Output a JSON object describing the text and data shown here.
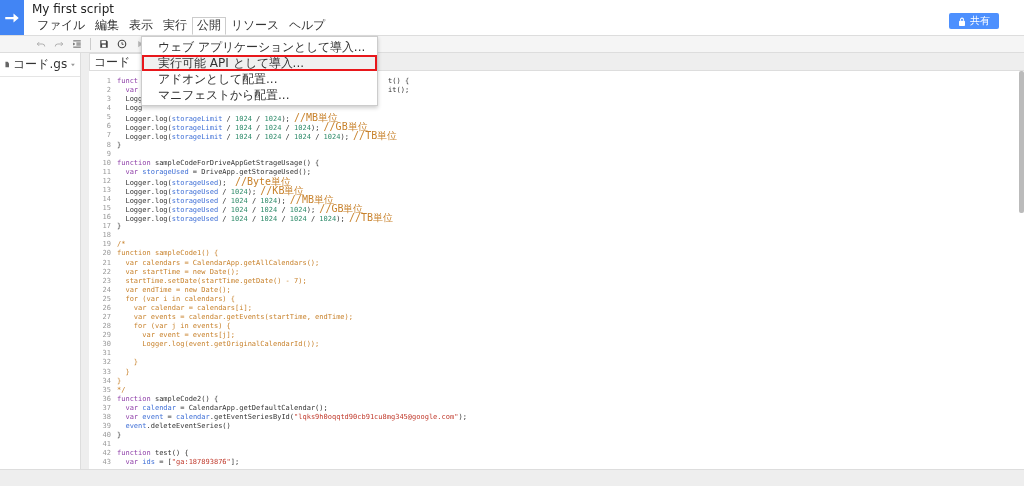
{
  "header": {
    "title": "My first script",
    "share_button": "共有"
  },
  "menu": [
    {
      "label": "ファイル",
      "selected": false
    },
    {
      "label": "編集",
      "selected": false
    },
    {
      "label": "表示",
      "selected": false
    },
    {
      "label": "実行",
      "selected": false
    },
    {
      "label": "公開",
      "selected": true
    },
    {
      "label": "リソース",
      "selected": false
    },
    {
      "label": "ヘルプ",
      "selected": false
    }
  ],
  "dropdown": [
    {
      "label": "ウェブ アプリケーションとして導入...",
      "highlighted": false
    },
    {
      "label": "実行可能 API として導入...",
      "highlighted": true
    },
    {
      "label": "アドオンとして配置...",
      "highlighted": false
    },
    {
      "label": "マニフェストから配置...",
      "highlighted": false
    }
  ],
  "files": [
    {
      "name": "コード.gs"
    }
  ],
  "editor_tab": "コード",
  "lines": [
    {
      "n": "1",
      "s": [
        {
          "t": "funct",
          "kind": "kw"
        },
        {
          "t": "t() {",
          "kind": "cover"
        }
      ]
    },
    {
      "n": "2",
      "s": [
        {
          "t": "  var",
          "kind": "kw"
        },
        {
          "t": "it();",
          "kind": "cover"
        }
      ]
    },
    {
      "n": "3",
      "s": [
        {
          "t": "  Logg",
          "kind": "pl"
        }
      ]
    },
    {
      "n": "4",
      "s": [
        {
          "t": "  Logg",
          "kind": "pl"
        }
      ]
    },
    {
      "n": "5",
      "s": [
        {
          "t": "  Logger.log(",
          "kind": "pl"
        },
        {
          "t": "storageLimit",
          "kind": "id"
        },
        {
          "t": " / ",
          "kind": "pl"
        },
        {
          "t": "1024",
          "kind": "num"
        },
        {
          "t": " / ",
          "kind": "pl"
        },
        {
          "t": "1024",
          "kind": "num"
        },
        {
          "t": "); ",
          "kind": "pl"
        },
        {
          "t": "//MB単位",
          "kind": "com"
        }
      ]
    },
    {
      "n": "6",
      "s": [
        {
          "t": "  Logger.log(",
          "kind": "pl"
        },
        {
          "t": "storageLimit",
          "kind": "id"
        },
        {
          "t": " / ",
          "kind": "pl"
        },
        {
          "t": "1024",
          "kind": "num"
        },
        {
          "t": " / ",
          "kind": "pl"
        },
        {
          "t": "1024",
          "kind": "num"
        },
        {
          "t": " / ",
          "kind": "pl"
        },
        {
          "t": "1024",
          "kind": "num"
        },
        {
          "t": "); ",
          "kind": "pl"
        },
        {
          "t": "//GB単位",
          "kind": "com"
        }
      ]
    },
    {
      "n": "7",
      "s": [
        {
          "t": "  Logger.log(",
          "kind": "pl"
        },
        {
          "t": "storageLimit",
          "kind": "id"
        },
        {
          "t": " / ",
          "kind": "pl"
        },
        {
          "t": "1024",
          "kind": "num"
        },
        {
          "t": " / ",
          "kind": "pl"
        },
        {
          "t": "1024",
          "kind": "num"
        },
        {
          "t": " / ",
          "kind": "pl"
        },
        {
          "t": "1024",
          "kind": "num"
        },
        {
          "t": " / ",
          "kind": "pl"
        },
        {
          "t": "1024",
          "kind": "num"
        },
        {
          "t": "); ",
          "kind": "pl"
        },
        {
          "t": "//TB単位",
          "kind": "com"
        }
      ]
    },
    {
      "n": "8",
      "s": [
        {
          "t": "}",
          "kind": "pl"
        }
      ]
    },
    {
      "n": "9"
    },
    {
      "n": "10",
      "s": [
        {
          "t": "function",
          "kind": "kw"
        },
        {
          "t": " sampleCodeForDriveAppGetStrageUsage() {",
          "kind": "pl"
        }
      ]
    },
    {
      "n": "11",
      "s": [
        {
          "t": "  var",
          "kind": "kw"
        },
        {
          "t": " storageUsed",
          "kind": "id"
        },
        {
          "t": " = DriveApp.getStorageUsed();",
          "kind": "pl"
        }
      ]
    },
    {
      "n": "12",
      "s": [
        {
          "t": "  Logger.log(",
          "kind": "pl"
        },
        {
          "t": "storageUsed",
          "kind": "id"
        },
        {
          "t": ");  ",
          "kind": "pl"
        },
        {
          "t": "//Byte単位",
          "kind": "com"
        }
      ]
    },
    {
      "n": "13",
      "s": [
        {
          "t": "  Logger.log(",
          "kind": "pl"
        },
        {
          "t": "storageUsed",
          "kind": "id"
        },
        {
          "t": " / ",
          "kind": "pl"
        },
        {
          "t": "1024",
          "kind": "num"
        },
        {
          "t": "); ",
          "kind": "pl"
        },
        {
          "t": "//KB単位",
          "kind": "com"
        }
      ]
    },
    {
      "n": "14",
      "s": [
        {
          "t": "  Logger.log(",
          "kind": "pl"
        },
        {
          "t": "storageUsed",
          "kind": "id"
        },
        {
          "t": " / ",
          "kind": "pl"
        },
        {
          "t": "1024",
          "kind": "num"
        },
        {
          "t": " / ",
          "kind": "pl"
        },
        {
          "t": "1024",
          "kind": "num"
        },
        {
          "t": "); ",
          "kind": "pl"
        },
        {
          "t": "//MB単位",
          "kind": "com"
        }
      ]
    },
    {
      "n": "15",
      "s": [
        {
          "t": "  Logger.log(",
          "kind": "pl"
        },
        {
          "t": "storageUsed",
          "kind": "id"
        },
        {
          "t": " / ",
          "kind": "pl"
        },
        {
          "t": "1024",
          "kind": "num"
        },
        {
          "t": " / ",
          "kind": "pl"
        },
        {
          "t": "1024",
          "kind": "num"
        },
        {
          "t": " / ",
          "kind": "pl"
        },
        {
          "t": "1024",
          "kind": "num"
        },
        {
          "t": "); ",
          "kind": "pl"
        },
        {
          "t": "//GB単位",
          "kind": "com"
        }
      ]
    },
    {
      "n": "16",
      "s": [
        {
          "t": "  Logger.log(",
          "kind": "pl"
        },
        {
          "t": "storageUsed",
          "kind": "id"
        },
        {
          "t": " / ",
          "kind": "pl"
        },
        {
          "t": "1024",
          "kind": "num"
        },
        {
          "t": " / ",
          "kind": "pl"
        },
        {
          "t": "1024",
          "kind": "num"
        },
        {
          "t": " / ",
          "kind": "pl"
        },
        {
          "t": "1024",
          "kind": "num"
        },
        {
          "t": " / ",
          "kind": "pl"
        },
        {
          "t": "1024",
          "kind": "num"
        },
        {
          "t": "); ",
          "kind": "pl"
        },
        {
          "t": "//TB単位",
          "kind": "com"
        }
      ]
    },
    {
      "n": "17",
      "s": [
        {
          "t": "}",
          "kind": "pl"
        }
      ]
    },
    {
      "n": "18"
    },
    {
      "n": "19",
      "s": [
        {
          "t": "/*",
          "kind": "cmt"
        }
      ]
    },
    {
      "n": "20",
      "s": [
        {
          "t": "function sampleCode1() {",
          "kind": "cmt"
        }
      ]
    },
    {
      "n": "21",
      "s": [
        {
          "t": "  var calendars = CalendarApp.getAllCalendars();",
          "kind": "cmt"
        }
      ]
    },
    {
      "n": "22",
      "s": [
        {
          "t": "  var startTime = new Date();",
          "kind": "cmt"
        }
      ]
    },
    {
      "n": "23",
      "s": [
        {
          "t": "  startTime.setDate(startTime.getDate() - 7);",
          "kind": "cmt"
        }
      ]
    },
    {
      "n": "24",
      "s": [
        {
          "t": "  var endTime = new Date();",
          "kind": "cmt"
        }
      ]
    },
    {
      "n": "25",
      "s": [
        {
          "t": "  for (var i in calendars) {",
          "kind": "cmt"
        }
      ]
    },
    {
      "n": "26",
      "s": [
        {
          "t": "    var calendar = calendars[i];",
          "kind": "cmt"
        }
      ]
    },
    {
      "n": "27",
      "s": [
        {
          "t": "    var events = calendar.getEvents(startTime, endTime);",
          "kind": "cmt"
        }
      ]
    },
    {
      "n": "28",
      "s": [
        {
          "t": "    for (var j in events) {",
          "kind": "cmt"
        }
      ]
    },
    {
      "n": "29",
      "s": [
        {
          "t": "      var event = events[j];",
          "kind": "cmt"
        }
      ]
    },
    {
      "n": "30",
      "s": [
        {
          "t": "      Logger.log(event.getOriginalCalendarId());",
          "kind": "cmt"
        }
      ]
    },
    {
      "n": "31"
    },
    {
      "n": "32",
      "s": [
        {
          "t": "    }",
          "kind": "cmt"
        }
      ]
    },
    {
      "n": "33",
      "s": [
        {
          "t": "  }",
          "kind": "cmt"
        }
      ]
    },
    {
      "n": "34",
      "s": [
        {
          "t": "}",
          "kind": "cmt"
        }
      ]
    },
    {
      "n": "35",
      "s": [
        {
          "t": "*/",
          "kind": "cmt"
        }
      ]
    },
    {
      "n": "36",
      "s": [
        {
          "t": "function",
          "kind": "kw"
        },
        {
          "t": " sampleCode2() {",
          "kind": "pl"
        }
      ]
    },
    {
      "n": "37",
      "s": [
        {
          "t": "  var",
          "kind": "kw"
        },
        {
          "t": " calendar",
          "kind": "id"
        },
        {
          "t": " = CalendarApp.getDefaultCalendar();",
          "kind": "pl"
        }
      ]
    },
    {
      "n": "38",
      "s": [
        {
          "t": "  var",
          "kind": "kw"
        },
        {
          "t": " event",
          "kind": "id"
        },
        {
          "t": " = ",
          "kind": "pl"
        },
        {
          "t": "calendar",
          "kind": "id"
        },
        {
          "t": ".getEventSeriesById(",
          "kind": "pl"
        },
        {
          "t": "\"lqks9h0oqqtd90cb91cu8mg345@google.com\"",
          "kind": "str"
        },
        {
          "t": ");",
          "kind": "pl"
        }
      ]
    },
    {
      "n": "39",
      "s": [
        {
          "t": "  event",
          "kind": "id"
        },
        {
          "t": ".deleteEventSeries()",
          "kind": "pl"
        }
      ]
    },
    {
      "n": "40",
      "s": [
        {
          "t": "}",
          "kind": "pl"
        }
      ]
    },
    {
      "n": "41"
    },
    {
      "n": "42",
      "s": [
        {
          "t": "function",
          "kind": "kw"
        },
        {
          "t": " test() {",
          "kind": "pl"
        }
      ]
    },
    {
      "n": "43",
      "s": [
        {
          "t": "  var",
          "kind": "kw"
        },
        {
          "t": " ids",
          "kind": "id"
        },
        {
          "t": " = [",
          "kind": "pl"
        },
        {
          "t": "\"ga:187893876\"",
          "kind": "str"
        },
        {
          "t": "];",
          "kind": "pl"
        }
      ]
    }
  ]
}
